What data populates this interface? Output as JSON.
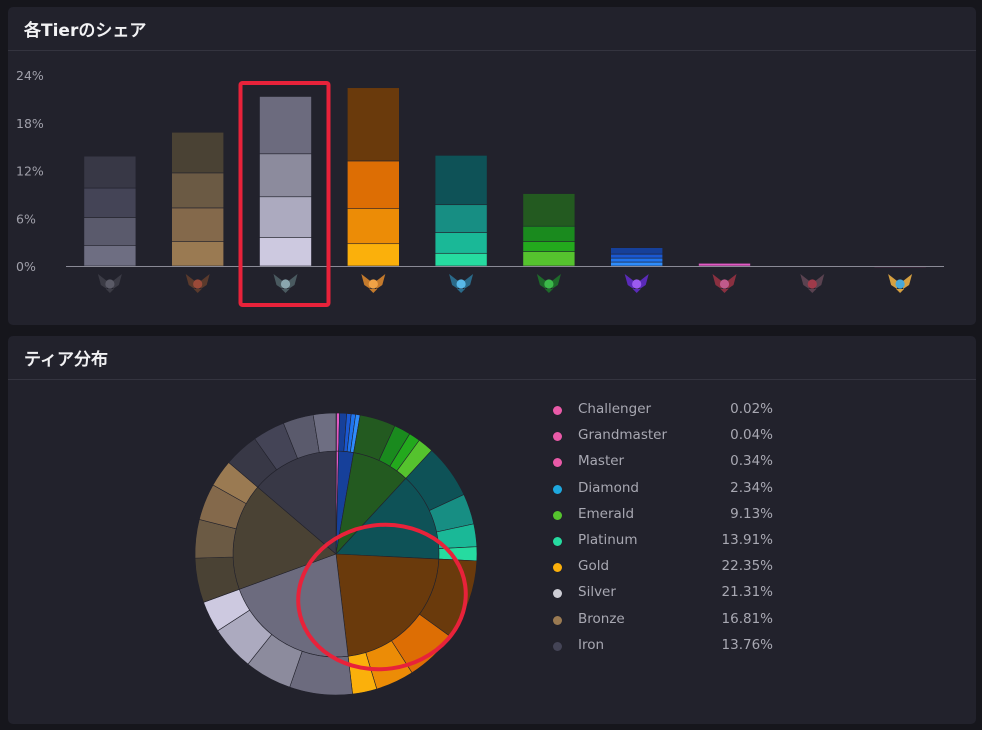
{
  "panels": {
    "share": {
      "title": "各Tierのシェア"
    },
    "distribution": {
      "title": "ティア分布"
    }
  },
  "chart_data": [
    {
      "type": "bar",
      "stacked": true,
      "title": "各Tierのシェア",
      "categories": [
        "Iron",
        "Bronze",
        "Silver",
        "Gold",
        "Platinum",
        "Emerald",
        "Diamond",
        "Master",
        "Grandmaster",
        "Challenger"
      ],
      "division_values": [
        [
          2.6,
          3.5,
          3.7,
          4.0
        ],
        [
          3.1,
          4.2,
          4.4,
          5.1
        ],
        [
          3.6,
          5.1,
          5.4,
          7.2
        ],
        [
          2.8,
          4.4,
          6.0,
          9.2
        ],
        [
          1.6,
          2.6,
          3.5,
          6.2
        ],
        [
          1.8,
          1.3,
          1.9,
          4.1
        ],
        [
          0.5,
          0.5,
          0.5,
          0.8
        ],
        [
          0.34
        ],
        [
          0.04
        ],
        [
          0.02
        ]
      ],
      "series_colors": [
        [
          "#6e6e82",
          "#5a5a6c",
          "#444456",
          "#383846"
        ],
        [
          "#9a7a52",
          "#84694b",
          "#6b5a44",
          "#4a4234"
        ],
        [
          "#cdc9e0",
          "#acaabf",
          "#8c8b9d",
          "#6c6b7e"
        ],
        [
          "#fbb00b",
          "#ec8c06",
          "#dd6e04",
          "#6a3a0c"
        ],
        [
          "#26dba0",
          "#1ab897",
          "#178e83",
          "#0e5257"
        ],
        [
          "#55c32e",
          "#23a91d",
          "#1a8a1e",
          "#235a20"
        ],
        [
          "#2e8cfb",
          "#1f74ee",
          "#1a58d2",
          "#16409a"
        ],
        [
          "#e25ac4"
        ],
        [
          "#c94a9e"
        ],
        [
          "#b5407f"
        ]
      ],
      "yticks": [
        "0%",
        "6%",
        "12%",
        "18%",
        "24%"
      ],
      "ylim": [
        0,
        24
      ],
      "x_icons": [
        "iron-emblem-icon",
        "bronze-emblem-icon",
        "silver-emblem-icon",
        "gold-emblem-icon",
        "platinum-emblem-icon",
        "emerald-emblem-icon",
        "diamond-emblem-icon",
        "master-emblem-icon",
        "grandmaster-emblem-icon",
        "challenger-emblem-icon"
      ],
      "icon_colors": [
        [
          "#3b3b45",
          "#5a5a66"
        ],
        [
          "#5a3a2c",
          "#9a4a38"
        ],
        [
          "#4a5a60",
          "#8aa6ae"
        ],
        [
          "#c47a2c",
          "#f0a246"
        ],
        [
          "#2a6a8a",
          "#58b8e8"
        ],
        [
          "#1e6a2a",
          "#3cb84a"
        ],
        [
          "#5a2ab8",
          "#9b5af0"
        ],
        [
          "#8a3040",
          "#c05a8a"
        ],
        [
          "#5a4250",
          "#a03a4a"
        ],
        [
          "#d6a040",
          "#48a8d8"
        ]
      ],
      "highlight": "Silver"
    },
    {
      "type": "pie",
      "title": "ティア分布",
      "labels": [
        "Challenger",
        "Grandmaster",
        "Master",
        "Diamond",
        "Emerald",
        "Platinum",
        "Gold",
        "Silver",
        "Bronze",
        "Iron"
      ],
      "values": [
        0.02,
        0.04,
        0.34,
        2.34,
        9.13,
        13.91,
        22.35,
        21.31,
        16.81,
        13.76
      ],
      "value_labels": [
        "0.02%",
        "0.04%",
        "0.34%",
        "2.34%",
        "9.13%",
        "13.91%",
        "22.35%",
        "21.31%",
        "16.81%",
        "13.76%"
      ],
      "legend_colors": [
        "#e95aa8",
        "#e95aa8",
        "#e95aa8",
        "#1ea8de",
        "#55c32e",
        "#26dba0",
        "#fbb00b",
        "#cdcdd5",
        "#9a7a52",
        "#444456"
      ],
      "highlight": "Silver"
    }
  ]
}
